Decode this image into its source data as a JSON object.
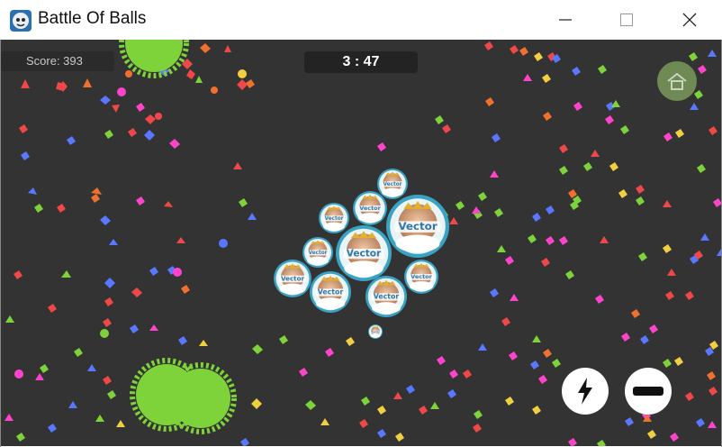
{
  "window": {
    "title": "Battle Of Balls"
  },
  "hud": {
    "score_text": "Score: 393",
    "timer_text": "3 : 47"
  },
  "player": {
    "name": "Vector"
  },
  "colors": {
    "background": "#333333",
    "spiky_green": "#7ed23a",
    "player_ring": "#3aa3c4"
  },
  "buttons": {
    "home_icon": "home-icon",
    "split_icon": "lightning-icon",
    "eject_icon": "minus-icon"
  }
}
